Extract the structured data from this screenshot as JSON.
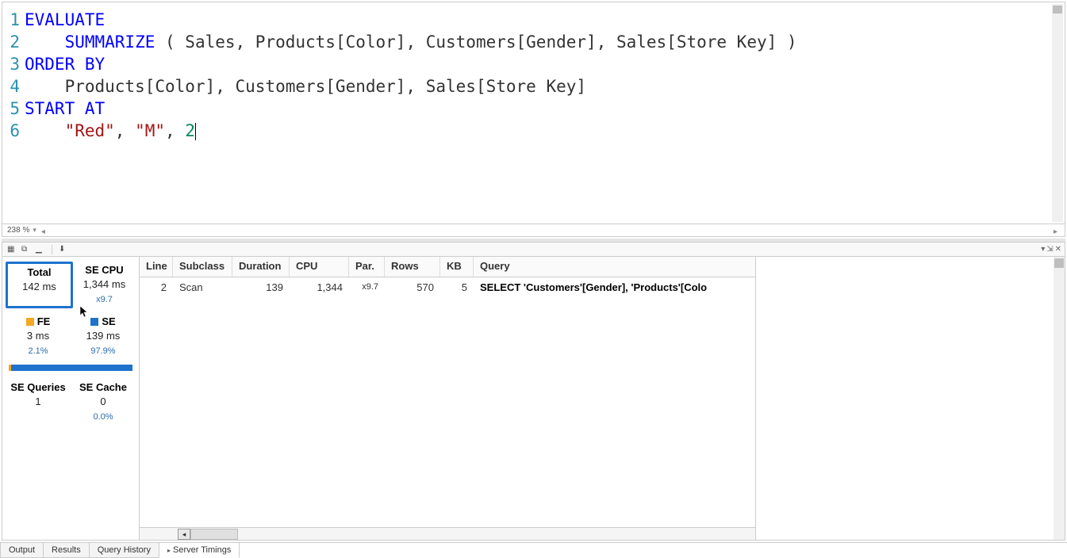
{
  "editor": {
    "zoom": "238 %",
    "lines": [
      {
        "n": "1",
        "tokens": [
          {
            "t": "EVALUATE",
            "c": "kw"
          }
        ]
      },
      {
        "n": "2",
        "tokens": [
          {
            "t": "    "
          },
          {
            "t": "SUMMARIZE",
            "c": "fn"
          },
          {
            "t": " ( Sales, Products[Color], Customers[Gender], Sales[Store Key] )"
          }
        ]
      },
      {
        "n": "3",
        "tokens": [
          {
            "t": "ORDER BY",
            "c": "kw"
          }
        ]
      },
      {
        "n": "4",
        "tokens": [
          {
            "t": "    Products[Color], Customers[Gender], Sales[Store Key]"
          }
        ]
      },
      {
        "n": "5",
        "tokens": [
          {
            "t": "START AT",
            "c": "kw"
          }
        ]
      },
      {
        "n": "6",
        "tokens": [
          {
            "t": "    "
          },
          {
            "t": "\"Red\"",
            "c": "str"
          },
          {
            "t": ", "
          },
          {
            "t": "\"M\"",
            "c": "str"
          },
          {
            "t": ", "
          },
          {
            "t": "2",
            "c": "num"
          }
        ],
        "cursor": true
      }
    ]
  },
  "stats": {
    "total": {
      "label": "Total",
      "value": "142 ms"
    },
    "secpu": {
      "label": "SE CPU",
      "value": "1,344 ms",
      "sub": "x9.7"
    },
    "fe": {
      "label": "FE",
      "value": "3 ms",
      "sub": "2.1%"
    },
    "se": {
      "label": "SE",
      "value": "139 ms",
      "sub": "97.9%"
    },
    "seq": {
      "label": "SE Queries",
      "value": "1"
    },
    "secache": {
      "label": "SE Cache",
      "value": "0",
      "sub": "0.0%"
    },
    "se_pct": 97.9
  },
  "grid": {
    "headers": {
      "line": "Line",
      "sub": "Subclass",
      "dur": "Duration",
      "cpu": "CPU",
      "par": "Par.",
      "rows": "Rows",
      "kb": "KB",
      "q": "Query"
    },
    "rows": [
      {
        "line": "2",
        "sub": "Scan",
        "dur": "139",
        "cpu": "1,344",
        "par": "x9.7",
        "rows": "570",
        "kb": "5",
        "q": "SELECT 'Customers'[Gender], 'Products'[Colo"
      }
    ]
  },
  "bottom_tabs": {
    "output": "Output",
    "results": "Results",
    "history": "Query History",
    "timings": "Server Timings"
  }
}
